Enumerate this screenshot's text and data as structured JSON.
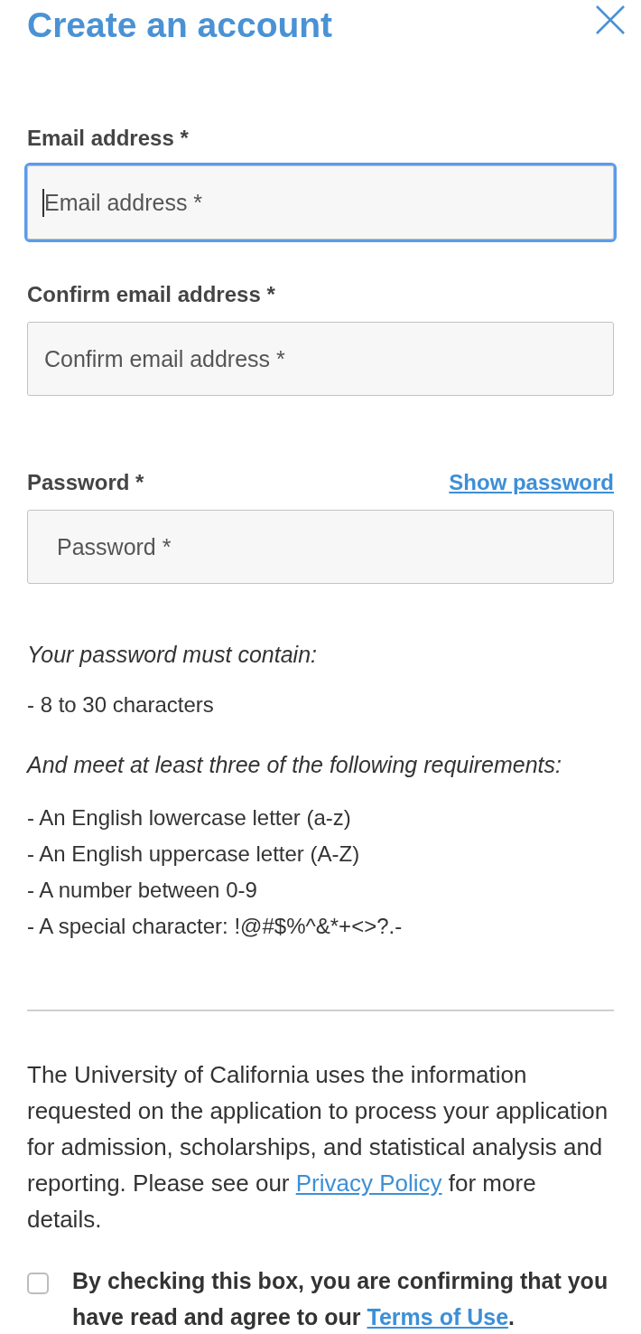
{
  "dialog": {
    "title": "Create an account"
  },
  "fields": [
    {
      "kind": "email",
      "label": "Email address *",
      "placeholder": "Email address *",
      "focused": true
    },
    {
      "kind": "email",
      "label": "Confirm email address *",
      "placeholder": "Confirm email address *",
      "focused": false
    },
    {
      "kind": "password",
      "label": "Password *",
      "placeholder": "Password *",
      "focused": false,
      "toggle_link": "Show password"
    }
  ],
  "password_rules": {
    "heading": "Your password must contain:",
    "required": [
      "- 8 to 30 characters"
    ],
    "subheading": "And meet at least three of the following requirements:",
    "options": [
      "- An English lowercase letter (a-z)",
      "- An English uppercase letter (A-Z)",
      "- A number between 0-9",
      "- A special character: !@#$%^&*+<>?.-"
    ]
  },
  "privacy_notice": {
    "text_before": "The University of California uses the information requested on the application to process your application for admission, scholarships, and statistical analysis and reporting. Please see our ",
    "link": "Privacy Policy",
    "text_after": " for more details."
  },
  "terms_checkbox": {
    "checked": false,
    "text_before": "By checking this box, you are confirming that you have read and agree to our ",
    "link": "Terms of Use",
    "text_after": "."
  }
}
